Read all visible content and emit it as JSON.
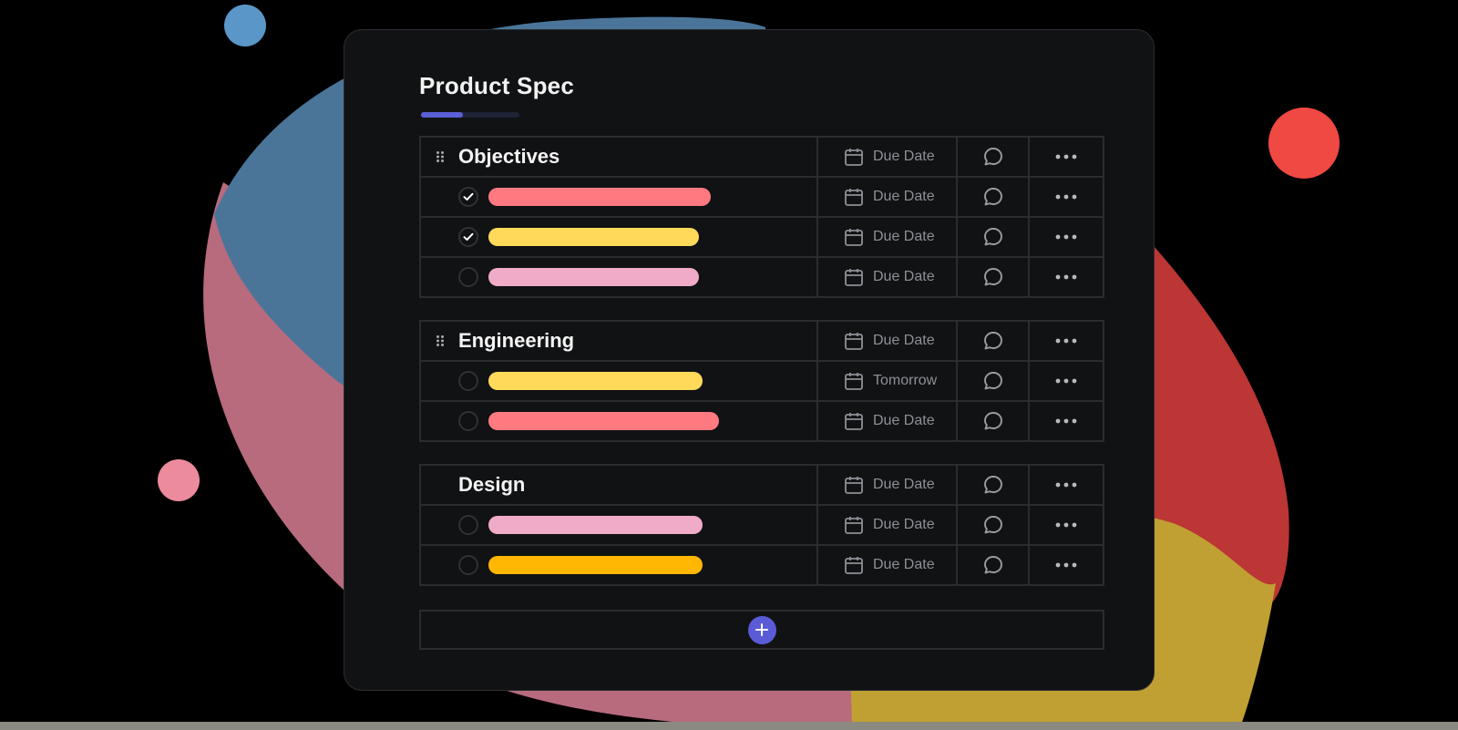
{
  "doc": {
    "title": "Product Spec",
    "progress_fraction": 0.43
  },
  "groups": [
    {
      "title": "Objectives",
      "header_date": "Due Date",
      "tasks": [
        {
          "done": true,
          "bar_color": "#ff7a80",
          "bar_fraction": 0.56,
          "date": "Due Date"
        },
        {
          "done": true,
          "bar_color": "#ffd95a",
          "bar_fraction": 0.53,
          "date": "Due Date"
        },
        {
          "done": false,
          "bar_color": "#f0abc8",
          "bar_fraction": 0.53,
          "date": "Due Date"
        }
      ]
    },
    {
      "title": "Engineering",
      "header_date": "Due Date",
      "tasks": [
        {
          "done": false,
          "bar_color": "#ffd95a",
          "bar_fraction": 0.54,
          "date": "Tomorrow"
        },
        {
          "done": false,
          "bar_color": "#ff7a80",
          "bar_fraction": 0.58,
          "date": "Due Date"
        }
      ]
    },
    {
      "title": "Design",
      "header_date": "Due Date",
      "tasks": [
        {
          "done": false,
          "bar_color": "#f0abc8",
          "bar_fraction": 0.54,
          "date": "Due Date"
        },
        {
          "done": false,
          "bar_color": "#ffb703",
          "bar_fraction": 0.54,
          "date": "Due Date"
        }
      ]
    }
  ],
  "icons": {
    "drag": "drag-handle-icon",
    "calendar": "calendar-icon",
    "comment": "comment-icon",
    "more": "more-icon",
    "check": "checkmark-icon",
    "add": "plus-icon"
  },
  "colors": {
    "accent": "#5a5bd6",
    "card_bg": "#111214",
    "border": "#2a2c30",
    "blob_blue": "#4a7599",
    "blob_pink": "#b76b7d",
    "blob_red": "#bb3634",
    "blob_yellow": "#c0a032",
    "dot_blue": "#5a97c8",
    "dot_red": "#f04843",
    "dot_pink": "#ec8b9d"
  }
}
